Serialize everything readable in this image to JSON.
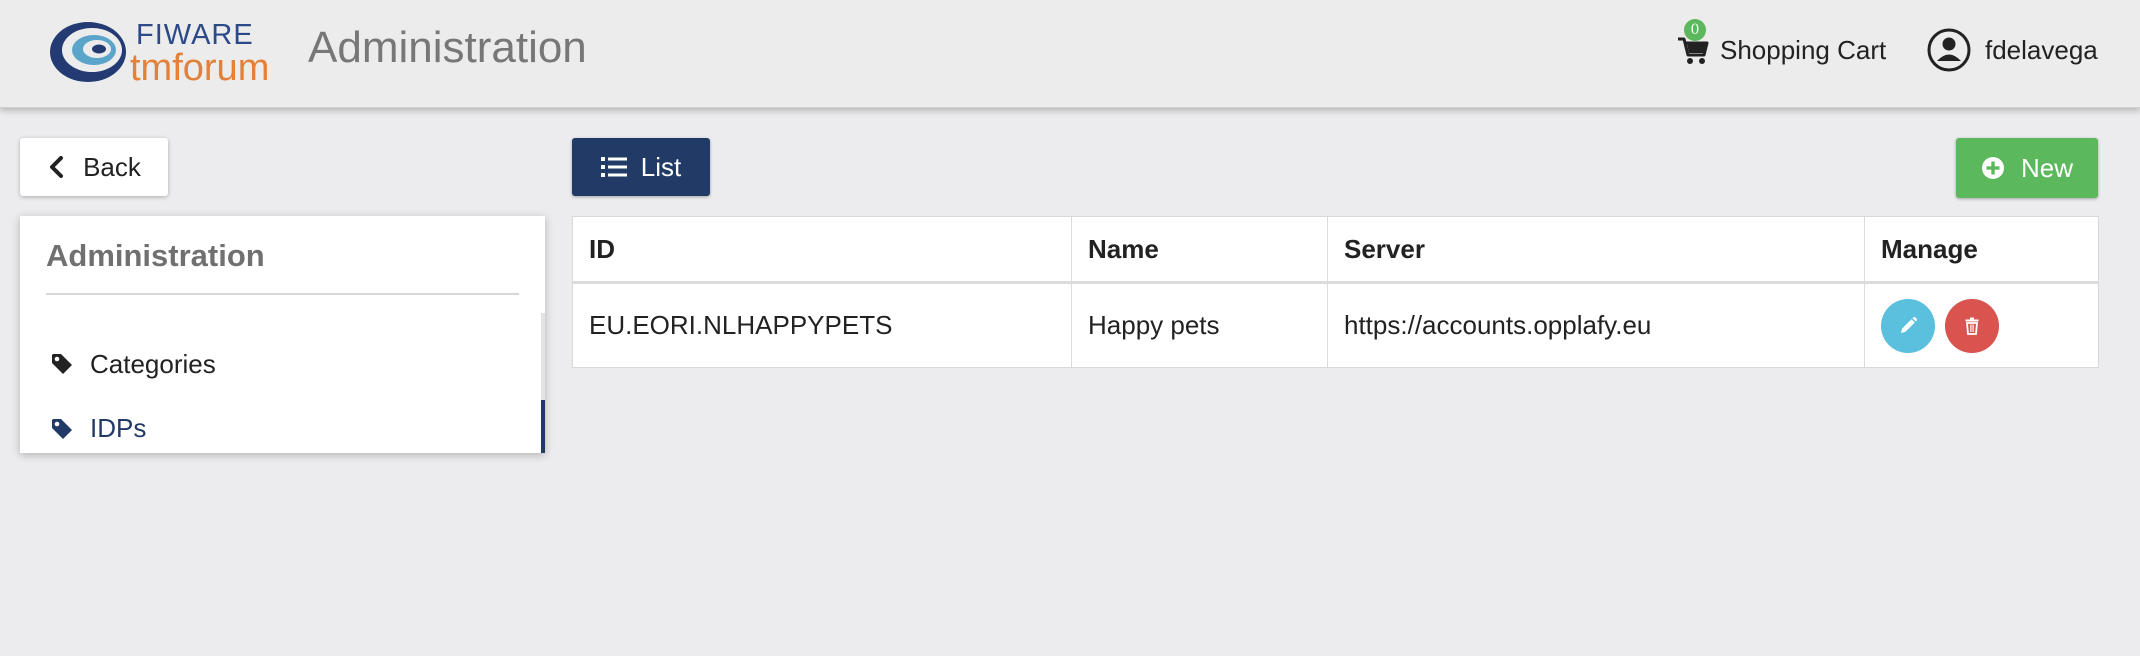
{
  "header": {
    "logo_top": "FIWARE",
    "logo_bottom": "tmforum",
    "title": "Administration",
    "cart_count": "0",
    "cart_label": "Shopping Cart",
    "username": "fdelavega"
  },
  "sidebar": {
    "back_label": "Back",
    "title": "Administration",
    "items": [
      {
        "label": "Categories",
        "icon": "tag-icon",
        "active": false
      },
      {
        "label": "IDPs",
        "icon": "tag-icon",
        "active": true
      }
    ]
  },
  "toolbar": {
    "list_label": "List",
    "new_label": "New"
  },
  "table": {
    "columns": [
      "ID",
      "Name",
      "Server",
      "Manage"
    ],
    "rows": [
      {
        "id": "EU.EORI.NLHAPPYPETS",
        "name": "Happy pets",
        "server": "https://accounts.opplafy.eu"
      }
    ]
  },
  "colors": {
    "primary": "#213a66",
    "success": "#5cb85c",
    "info": "#5bc0de",
    "danger": "#d9534f"
  }
}
